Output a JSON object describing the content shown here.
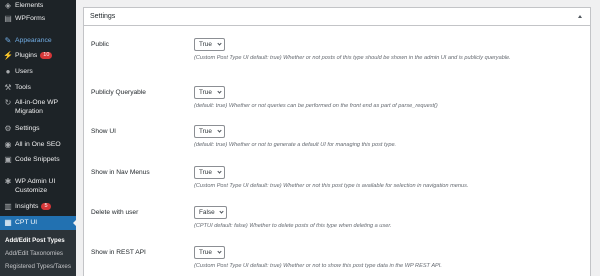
{
  "sidebar": {
    "items": [
      {
        "label": "Elements",
        "icon": "elements-icon",
        "glyph": "◈"
      },
      {
        "label": "WPForms",
        "icon": "wpforms-icon",
        "glyph": "▤"
      },
      {
        "label": "Appearance",
        "icon": "paintbrush-icon",
        "glyph": "✎"
      },
      {
        "label": "Plugins",
        "icon": "plug-icon",
        "glyph": "⚡",
        "badge": "10"
      },
      {
        "label": "Users",
        "icon": "user-icon",
        "glyph": "●"
      },
      {
        "label": "Tools",
        "icon": "wrench-icon",
        "glyph": "⚒"
      },
      {
        "label": "All-in-One WP",
        "label2": "Migration",
        "icon": "migration-icon",
        "glyph": "↻"
      },
      {
        "label": "Settings",
        "icon": "settings-icon",
        "glyph": "⚙"
      },
      {
        "label": "All in One SEO",
        "icon": "seo-icon",
        "glyph": "◉"
      },
      {
        "label": "Code Snippets",
        "icon": "code-icon",
        "glyph": "▣"
      },
      {
        "label": "WP Admin UI",
        "label2": "Customize",
        "icon": "customize-icon",
        "glyph": "✱"
      },
      {
        "label": "Insights",
        "icon": "insights-icon",
        "glyph": "▥",
        "badge": "5"
      },
      {
        "label": "CPT UI",
        "icon": "cptui-icon",
        "glyph": "▦"
      }
    ],
    "submenu": [
      {
        "label": "Add/Edit Post Types"
      },
      {
        "label": "Add/Edit Taxonomies"
      },
      {
        "label": "Registered Types/Taxes"
      }
    ]
  },
  "panel": {
    "title": "Settings"
  },
  "settings": [
    {
      "label": "Public",
      "value": "True",
      "description": "(Custom Post Type UI default: true) Whether or not posts of this type should be shown in the admin UI and is publicly queryable."
    },
    {
      "label": "Publicly Queryable",
      "value": "True",
      "description": "(default: true) Whether or not queries can be performed on the front end as part of parse_request()"
    },
    {
      "label": "Show UI",
      "value": "True",
      "description": "(default: true) Whether or not to generate a default UI for managing this post type."
    },
    {
      "label": "Show in Nav Menus",
      "value": "True",
      "description": "(Custom Post Type UI default: true) Whether or not this post type is available for selection in navigation menus."
    },
    {
      "label": "Delete with user",
      "value": "False",
      "description": "(CPTUI default: false) Whether to delete posts of this type when deleting a user."
    },
    {
      "label": "Show in REST API",
      "value": "True",
      "description": "(Custom Post Type UI default: true) Whether or not to show this post type data in the WP REST API."
    }
  ]
}
